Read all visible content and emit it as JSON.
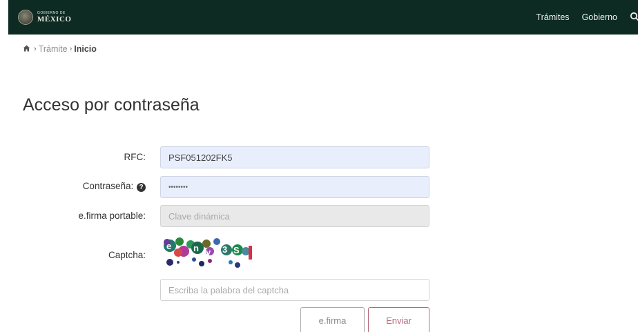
{
  "header": {
    "logo_small": "GOBIERNO DE",
    "logo_big": "MÉXICO",
    "nav": [
      "Trámites",
      "Gobierno"
    ],
    "search_icon": "search-icon"
  },
  "breadcrumb": {
    "home_icon": "home-icon",
    "items": [
      "Trámite",
      "Inicio"
    ]
  },
  "page": {
    "title": "Acceso por contraseña"
  },
  "form": {
    "rfc_label": "RFC:",
    "rfc_value": "PSF051202FK5",
    "password_label": "Contraseña:",
    "password_value": "••••••••",
    "efirma_portable_label": "e.firma portable:",
    "efirma_portable_placeholder": "Clave dinámica",
    "captcha_label": "Captcha:",
    "captcha_placeholder": "Escriba la palabra del captcha"
  },
  "buttons": {
    "efirma": "e.firma",
    "enviar": "Enviar"
  },
  "colors": {
    "header_bg": "#0d2b22",
    "input_filled_bg": "#e8eefc",
    "input_disabled_bg": "#e9e9e9",
    "enviar_accent": "#b56a7b"
  }
}
